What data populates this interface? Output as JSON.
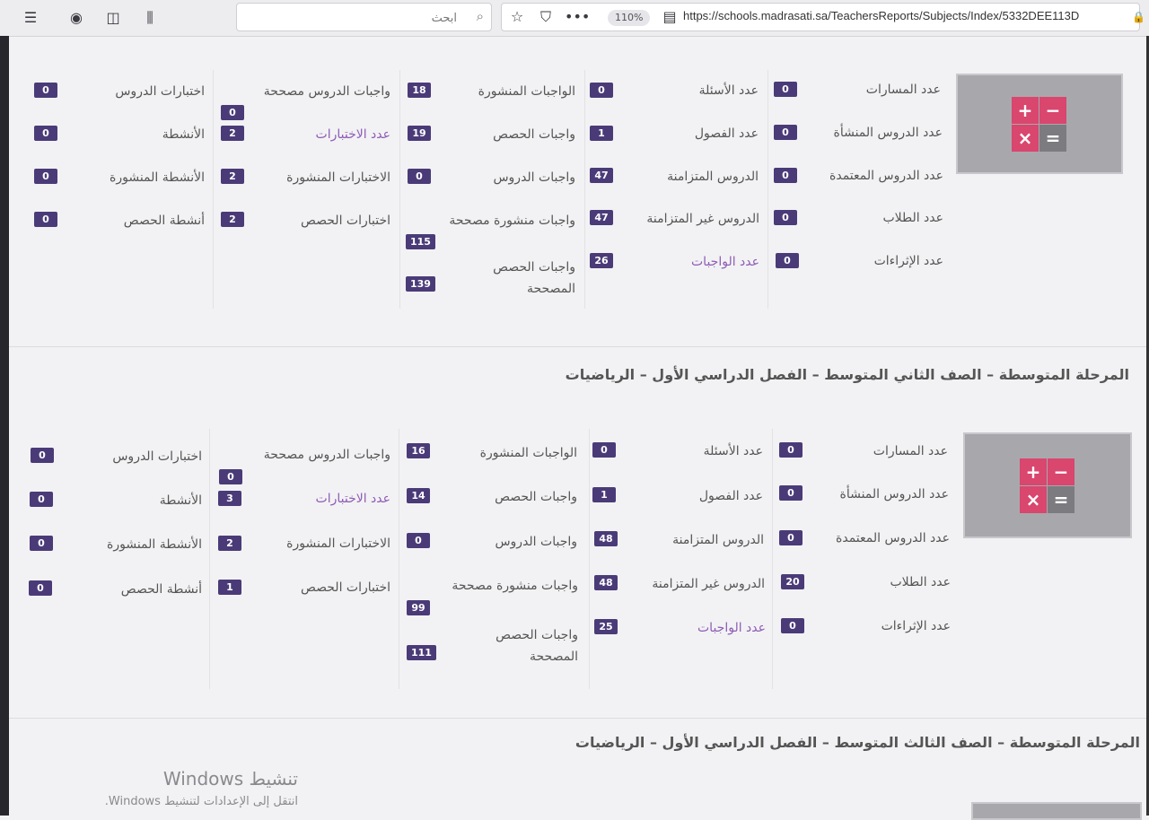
{
  "browser": {
    "search_placeholder": "ابحث",
    "zoom": "110%",
    "url": "https://schools.madrasati.sa/TeachersReports/Subjects/Index/5332DEE113D"
  },
  "sections": [
    {
      "title": "",
      "col1": [
        {
          "label": "عدد المسارات",
          "value": "0"
        },
        {
          "label": "عدد الدروس المنشأة",
          "value": "0"
        },
        {
          "label": "عدد الدروس المعتمدة",
          "value": "0"
        },
        {
          "label": "عدد الطلاب",
          "value": "0"
        },
        {
          "label": "عدد الإثراءات",
          "value": "0"
        }
      ],
      "col2": [
        {
          "label": "عدد الأسئلة",
          "value": "0"
        },
        {
          "label": "عدد الفصول",
          "value": "1"
        },
        {
          "label": "الدروس المتزامنة",
          "value": "47"
        },
        {
          "label": "الدروس غير المتزامنة",
          "value": "47"
        },
        {
          "label": "عدد الواجبات",
          "value": "26"
        }
      ],
      "col3": [
        {
          "label": "الواجبات المنشورة",
          "value": "18"
        },
        {
          "label": "واجبات الحصص",
          "value": "19"
        },
        {
          "label": "واجبات الدروس",
          "value": "0"
        },
        {
          "label": "واجبات منشورة مصححة",
          "value": "115"
        },
        {
          "label": "واجبات الحصص المصححة",
          "value": "139"
        }
      ],
      "col4": [
        {
          "label": "واجبات الدروس مصححة",
          "value": "0"
        },
        {
          "label": "عدد الاختبارات",
          "value": "2"
        },
        {
          "label": "الاختبارات المنشورة",
          "value": "2"
        },
        {
          "label": "اختبارات الحصص",
          "value": "2"
        }
      ],
      "col5": [
        {
          "label": "اختبارات الدروس",
          "value": "0"
        },
        {
          "label": "الأنشطة",
          "value": "0"
        },
        {
          "label": "الأنشطة المنشورة",
          "value": "0"
        },
        {
          "label": "أنشطة الحصص",
          "value": "0"
        }
      ]
    },
    {
      "title": "المرحلة المتوسطة – الصف الثاني المتوسط – الفصل الدراسي الأول – الرياضيات",
      "col1": [
        {
          "label": "عدد المسارات",
          "value": "0"
        },
        {
          "label": "عدد الدروس المنشأة",
          "value": "0"
        },
        {
          "label": "عدد الدروس المعتمدة",
          "value": "0"
        },
        {
          "label": "عدد الطلاب",
          "value": "20"
        },
        {
          "label": "عدد الإثراءات",
          "value": "0"
        }
      ],
      "col2": [
        {
          "label": "عدد الأسئلة",
          "value": "0"
        },
        {
          "label": "عدد الفصول",
          "value": "1"
        },
        {
          "label": "الدروس المتزامنة",
          "value": "48"
        },
        {
          "label": "الدروس غير المتزامنة",
          "value": "48"
        },
        {
          "label": "عدد الواجبات",
          "value": "25"
        }
      ],
      "col3": [
        {
          "label": "الواجبات المنشورة",
          "value": "16"
        },
        {
          "label": "واجبات الحصص",
          "value": "14"
        },
        {
          "label": "واجبات الدروس",
          "value": "0"
        },
        {
          "label": "واجبات منشورة مصححة",
          "value": "99"
        },
        {
          "label": "واجبات الحصص المصححة",
          "value": "111"
        }
      ],
      "col4": [
        {
          "label": "واجبات الدروس مصححة",
          "value": "0"
        },
        {
          "label": "عدد الاختبارات",
          "value": "3"
        },
        {
          "label": "الاختبارات المنشورة",
          "value": "2"
        },
        {
          "label": "اختبارات الحصص",
          "value": "1"
        }
      ],
      "col5": [
        {
          "label": "اختبارات الدروس",
          "value": "0"
        },
        {
          "label": "الأنشطة",
          "value": "0"
        },
        {
          "label": "الأنشطة المنشورة",
          "value": "0"
        },
        {
          "label": "أنشطة الحصص",
          "value": "0"
        }
      ]
    },
    {
      "title": "المرحلة المتوسطة – الصف الثالث المتوسط – الفصل الدراسي الأول – الرياضيات"
    }
  ],
  "calc_keys": [
    "+",
    "−",
    "×",
    "="
  ],
  "watermark": {
    "title": "تنشيط Windows",
    "subtitle": "انتقل إلى الإعدادات لتنشيط Windows."
  }
}
